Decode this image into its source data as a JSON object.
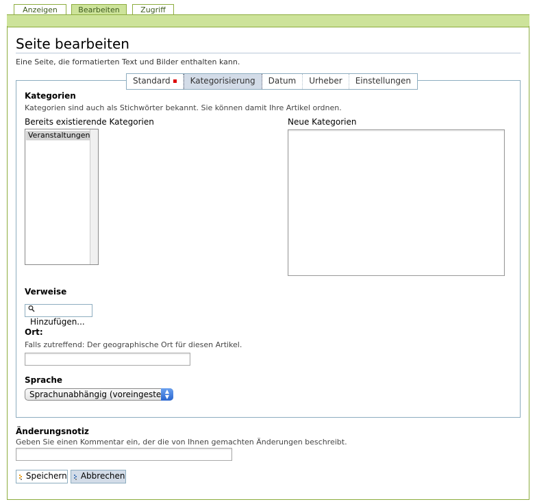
{
  "top_tabs": [
    {
      "label": "Anzeigen",
      "active": false
    },
    {
      "label": "Bearbeiten",
      "active": true
    },
    {
      "label": "Zugriff",
      "active": false
    }
  ],
  "page": {
    "title": "Seite bearbeiten",
    "description": "Eine Seite, die formatierten Text und Bilder enthalten kann."
  },
  "sub_tabs": [
    {
      "label": "Standard",
      "active": false,
      "required": true
    },
    {
      "label": "Kategorisierung",
      "active": true
    },
    {
      "label": "Datum",
      "active": false
    },
    {
      "label": "Urheber",
      "active": false
    },
    {
      "label": "Einstellungen",
      "active": false
    }
  ],
  "categories": {
    "heading": "Kategorien",
    "help": "Kategorien sind auch als Stichwörter bekannt. Sie können damit Ihre Artikel ordnen.",
    "existing_label": "Bereits existierende Kategorien",
    "existing_items": [
      "Veranstaltungen"
    ],
    "new_label": "Neue Kategorien"
  },
  "references": {
    "heading": "Verweise",
    "add_button": "Hinzufügen..."
  },
  "location": {
    "heading": "Ort:",
    "help": "Falls zutreffend: Der geographische Ort für diesen Artikel."
  },
  "language": {
    "heading": "Sprache",
    "selected": "Sprachunabhängig (voreingestellt)"
  },
  "change_note": {
    "heading": "Änderungsnotiz",
    "help": "Geben Sie einen Kommentar ein, der die von Ihnen gemachten Änderungen beschreibt."
  },
  "actions": {
    "save": "Speichern",
    "cancel": "Abbrechen"
  },
  "colors": {
    "accent_green": "#cde39a",
    "border_green": "#8cac3d",
    "border_blue": "#8cacbf",
    "required_red": "#dd0000"
  }
}
